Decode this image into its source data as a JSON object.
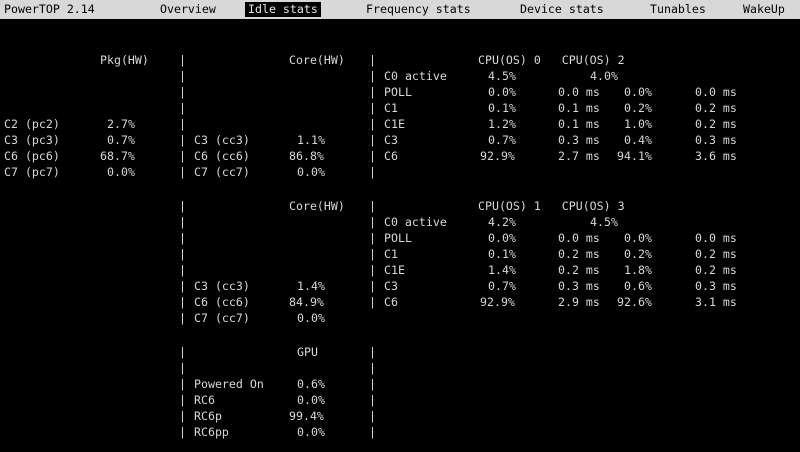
{
  "top_bar": {
    "app_title": "PowerTOP 2.14",
    "tabs": [
      {
        "label": "Overview"
      },
      {
        "label": "Idle stats",
        "active": true
      },
      {
        "label": "Frequency stats"
      },
      {
        "label": "Device stats"
      },
      {
        "label": "Tunables"
      },
      {
        "label": "WakeUp"
      }
    ]
  },
  "pkg": {
    "header": "Pkg(HW)",
    "states": [
      {
        "name": "C2 (pc2)",
        "value": "2.7%"
      },
      {
        "name": "C3 (pc3)",
        "value": "0.7%"
      },
      {
        "name": "C6 (pc6)",
        "value": "68.7%"
      },
      {
        "name": "C7 (pc7)",
        "value": "0.0%"
      }
    ]
  },
  "core_a": {
    "header": "Core(HW)",
    "states": [
      {
        "name": "C3 (cc3)",
        "value": "1.1%"
      },
      {
        "name": "C6 (cc6)",
        "value": "86.8%"
      },
      {
        "name": "C7 (cc7)",
        "value": "0.0%"
      }
    ]
  },
  "cpu_a": {
    "header": "CPU(OS) 0   CPU(OS) 2",
    "rows": [
      {
        "state": "C0 active",
        "v1": "4.5%",
        "t1": "",
        "v2": "4.0%",
        "t2": ""
      },
      {
        "state": "POLL",
        "v1": "0.0%",
        "t1": "0.0 ms",
        "v2": "0.0%",
        "t2": "0.0 ms"
      },
      {
        "state": "C1",
        "v1": "0.1%",
        "t1": "0.1 ms",
        "v2": "0.2%",
        "t2": "0.2 ms"
      },
      {
        "state": "C1E",
        "v1": "1.2%",
        "t1": "0.1 ms",
        "v2": "1.0%",
        "t2": "0.2 ms"
      },
      {
        "state": "C3",
        "v1": "0.7%",
        "t1": "0.3 ms",
        "v2": "0.4%",
        "t2": "0.3 ms"
      },
      {
        "state": "C6",
        "v1": "92.9%",
        "t1": "2.7 ms",
        "v2": "94.1%",
        "t2": "3.6 ms"
      }
    ]
  },
  "core_b": {
    "header": "Core(HW)",
    "states": [
      {
        "name": "C3 (cc3)",
        "value": "1.4%"
      },
      {
        "name": "C6 (cc6)",
        "value": "84.9%"
      },
      {
        "name": "C7 (cc7)",
        "value": "0.0%"
      }
    ]
  },
  "cpu_b": {
    "header": "CPU(OS) 1   CPU(OS) 3",
    "rows": [
      {
        "state": "C0 active",
        "v1": "4.2%",
        "t1": "",
        "v2": "4.5%",
        "t2": ""
      },
      {
        "state": "POLL",
        "v1": "0.0%",
        "t1": "0.0 ms",
        "v2": "0.0%",
        "t2": "0.0 ms"
      },
      {
        "state": "C1",
        "v1": "0.1%",
        "t1": "0.2 ms",
        "v2": "0.2%",
        "t2": "0.2 ms"
      },
      {
        "state": "C1E",
        "v1": "1.4%",
        "t1": "0.2 ms",
        "v2": "1.8%",
        "t2": "0.2 ms"
      },
      {
        "state": "C3",
        "v1": "0.7%",
        "t1": "0.3 ms",
        "v2": "0.6%",
        "t2": "0.3 ms"
      },
      {
        "state": "C6",
        "v1": "92.9%",
        "t1": "2.9 ms",
        "v2": "92.6%",
        "t2": "3.1 ms"
      }
    ]
  },
  "gpu": {
    "header": "GPU",
    "states": [
      {
        "name": "Powered On",
        "value": "0.6%"
      },
      {
        "name": "RC6",
        "value": "0.0%"
      },
      {
        "name": "RC6p",
        "value": "99.4%"
      },
      {
        "name": "RC6pp",
        "value": "0.0%"
      }
    ]
  },
  "separator": "|"
}
